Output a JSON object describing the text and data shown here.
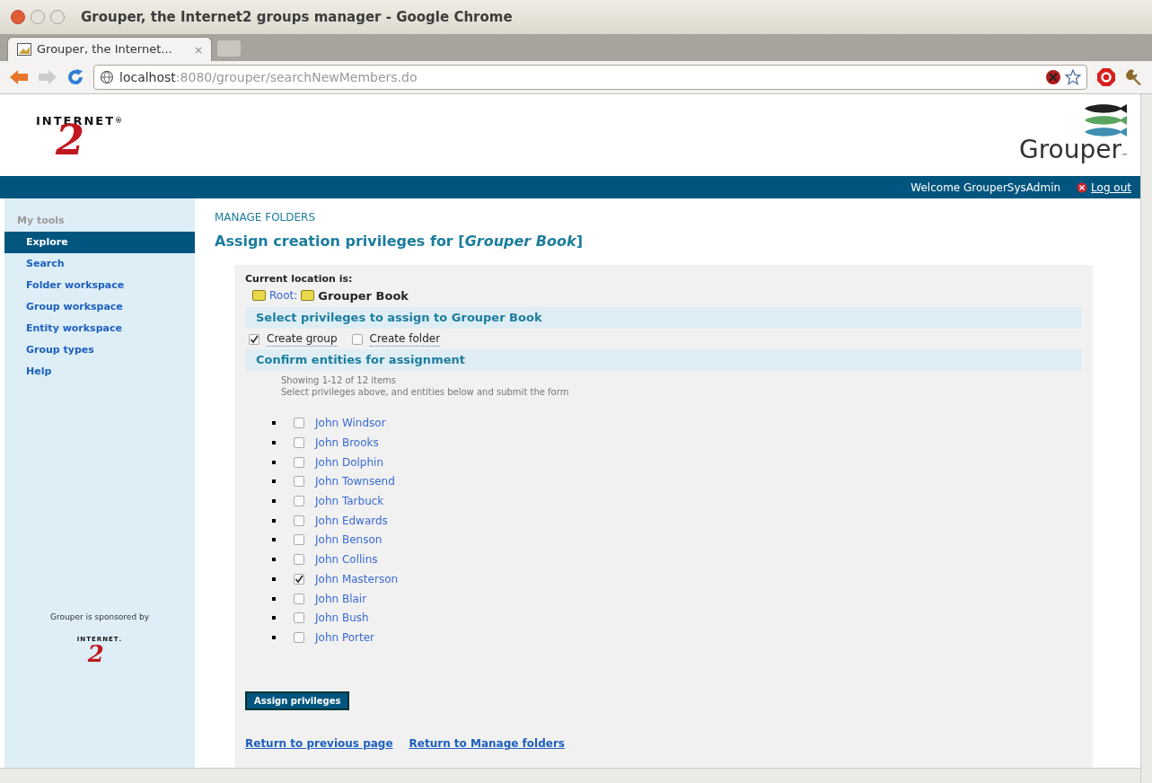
{
  "window": {
    "title": "Grouper, the Internet2 groups manager - Google Chrome"
  },
  "tabs": [
    {
      "label": "Grouper, the Internet...",
      "selected": true
    }
  ],
  "address_bar": {
    "host": "localhost",
    "rest": ":8080/grouper/searchNewMembers.do"
  },
  "header": {
    "left_logo": {
      "word": "INTERNET",
      "numeral": "2",
      "mark": "®"
    },
    "right_logo": {
      "word": "Grouper",
      "mark": "™"
    }
  },
  "top_bar": {
    "welcome": "Welcome GrouperSysAdmin",
    "logout": "Log out"
  },
  "sidebar": {
    "heading": "My tools",
    "items": [
      {
        "label": "Explore",
        "selected": true
      },
      {
        "label": "Search",
        "selected": false
      },
      {
        "label": "Folder workspace",
        "selected": false
      },
      {
        "label": "Group workspace",
        "selected": false
      },
      {
        "label": "Entity workspace",
        "selected": false
      },
      {
        "label": "Group types",
        "selected": false
      },
      {
        "label": "Help",
        "selected": false
      }
    ],
    "sponsor": "Grouper is sponsored by",
    "sponsor_logo": {
      "word": "INTERNET",
      "numeral": "2",
      "mark": "."
    }
  },
  "breadcrumb": "MANAGE FOLDERS",
  "title": "Assign creation privileges for [*Grouper Book*]",
  "location": {
    "label": "Current location is:",
    "root": "Root:",
    "current": "Grouper Book"
  },
  "privileges": {
    "heading": "Select privileges to assign to Grouper Book",
    "options": [
      {
        "label": "Create group",
        "checked": true
      },
      {
        "label": "Create folder",
        "checked": false
      }
    ]
  },
  "entities": {
    "heading": "Confirm entities for assignment",
    "count": "Showing 1-12 of 12 items",
    "hint": "Select privileges above, and entities below and submit the form",
    "items": [
      {
        "name": "John Windsor",
        "checked": false
      },
      {
        "name": "John Brooks",
        "checked": false
      },
      {
        "name": "John Dolphin",
        "checked": false
      },
      {
        "name": "John Townsend",
        "checked": false
      },
      {
        "name": "John Tarbuck",
        "checked": false
      },
      {
        "name": "John Edwards",
        "checked": false
      },
      {
        "name": "John Benson",
        "checked": false
      },
      {
        "name": "John Collins",
        "checked": false
      },
      {
        "name": "John Masterson",
        "checked": true
      },
      {
        "name": "John Blair",
        "checked": false
      },
      {
        "name": "John Bush",
        "checked": false
      },
      {
        "name": "John Porter",
        "checked": false
      }
    ]
  },
  "submit": "Assign privileges",
  "links": [
    "Return to previous page",
    "Return to Manage folders"
  ]
}
